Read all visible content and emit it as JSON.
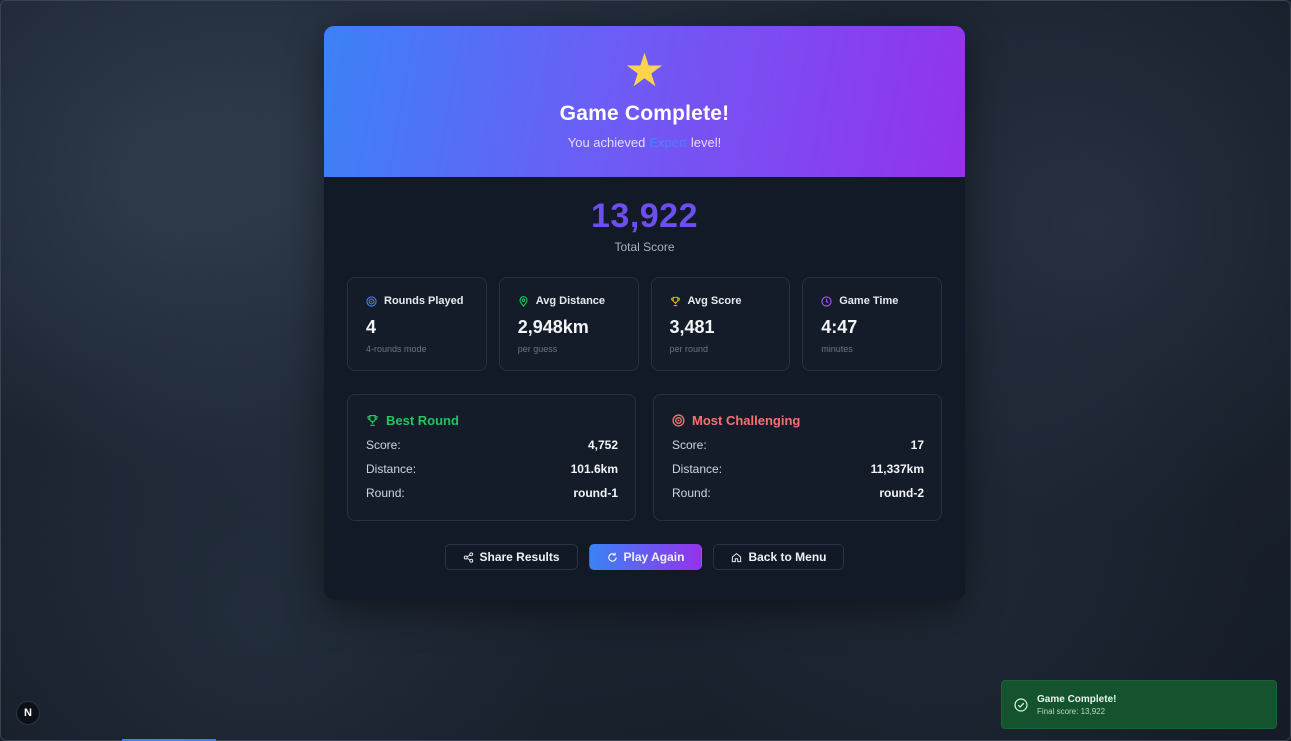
{
  "hero": {
    "icon": "star-icon",
    "title": "Game Complete!",
    "subtitle_prefix": "You achieved",
    "level": "Expert",
    "subtitle_suffix": "level!"
  },
  "total": {
    "score": "13,922",
    "label": "Total Score"
  },
  "stats": [
    {
      "icon": "target-icon",
      "label": "Rounds Played",
      "value": "4",
      "note": "4-rounds mode",
      "color": "#3b82f6"
    },
    {
      "icon": "map-pin-icon",
      "label": "Avg Distance",
      "value": "2,948km",
      "note": "per guess",
      "color": "#22c55e"
    },
    {
      "icon": "trophy-icon",
      "label": "Avg Score",
      "value": "3,481",
      "note": "per round",
      "color": "#eab308"
    },
    {
      "icon": "clock-icon",
      "label": "Game Time",
      "value": "4:47",
      "note": "minutes",
      "color": "#a855f7"
    }
  ],
  "best_round": {
    "title": "Best Round",
    "score_label": "Score:",
    "score": "4,752",
    "distance_label": "Distance:",
    "distance": "101.6km",
    "round_label": "Round:",
    "round": "round-1"
  },
  "most_challenging": {
    "title": "Most Challenging",
    "score_label": "Score:",
    "score": "17",
    "distance_label": "Distance:",
    "distance": "11,337km",
    "round_label": "Round:",
    "round": "round-2"
  },
  "actions": {
    "share": "Share Results",
    "play_again": "Play Again",
    "back": "Back to Menu"
  },
  "toast": {
    "title": "Game Complete!",
    "message": "Final score: 13,922"
  },
  "badge": "N"
}
